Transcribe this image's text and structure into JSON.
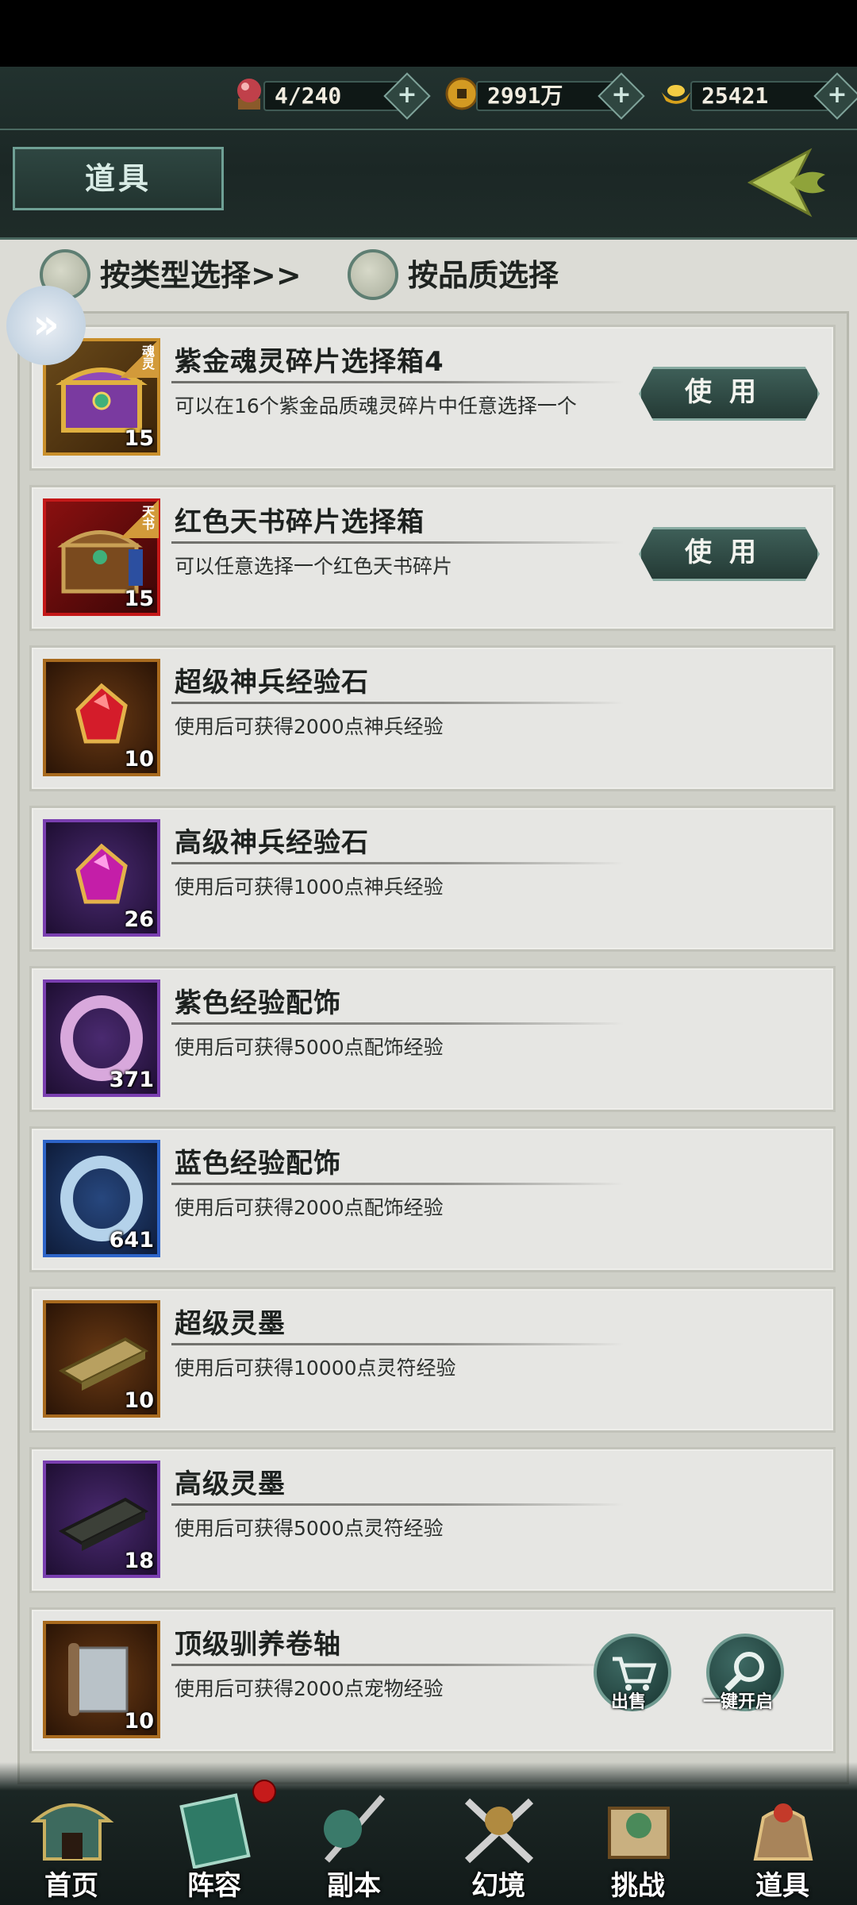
{
  "header": {
    "resources": [
      {
        "icon": "orb-icon",
        "value": "4/240"
      },
      {
        "icon": "coin-icon",
        "value": "2991万"
      },
      {
        "icon": "gold-ingot-icon",
        "value": "25421"
      }
    ],
    "title": "道具"
  },
  "filters": {
    "by_type": "按类型选择>>",
    "by_quality": "按品质选择"
  },
  "items": [
    {
      "name": "紫金魂灵碎片选择箱4",
      "desc": "可以在16个紫金品质魂灵碎片中任意选择一个",
      "qty": "15",
      "tag": "魂灵",
      "button": "使用",
      "icon": "purple-gold-chest-icon",
      "border": "#c98f2b"
    },
    {
      "name": "红色天书碎片选择箱",
      "desc": "可以任意选择一个红色天书碎片",
      "qty": "15",
      "tag": "天书",
      "button": "使用",
      "icon": "red-treasure-chest-icon",
      "border": "#c41818"
    },
    {
      "name": "超级神兵经验石",
      "desc": "使用后可获得2000点神兵经验",
      "qty": "10",
      "icon": "red-gem-icon",
      "border": "#a86a1e"
    },
    {
      "name": "高级神兵经验石",
      "desc": "使用后可获得1000点神兵经验",
      "qty": "26",
      "icon": "purple-gem-icon",
      "border": "#7a3fb0"
    },
    {
      "name": "紫色经验配饰",
      "desc": "使用后可获得5000点配饰经验",
      "qty": "371",
      "icon": "purple-ring-icon",
      "border": "#7a3fb0"
    },
    {
      "name": "蓝色经验配饰",
      "desc": "使用后可获得2000点配饰经验",
      "qty": "641",
      "icon": "blue-ring-icon",
      "border": "#2d64c8"
    },
    {
      "name": "超级灵墨",
      "desc": "使用后可获得10000点灵符经验",
      "qty": "10",
      "icon": "gold-ink-stick-icon",
      "border": "#a86a1e"
    },
    {
      "name": "高级灵墨",
      "desc": "使用后可获得5000点灵符经验",
      "qty": "18",
      "icon": "dark-ink-stick-icon",
      "border": "#7a3fb0"
    },
    {
      "name": "顶级驯养卷轴",
      "desc": "使用后可获得2000点宠物经验",
      "qty": "10",
      "icon": "scroll-icon",
      "border": "#a86a1e"
    }
  ],
  "actions": {
    "sell": "出售",
    "open_all": "一键开启"
  },
  "nav": [
    {
      "label": "首页",
      "icon": "home-pavilion-icon"
    },
    {
      "label": "阵容",
      "icon": "lineup-book-icon",
      "badge": true
    },
    {
      "label": "副本",
      "icon": "sword-warrior-icon"
    },
    {
      "label": "幻境",
      "icon": "crossed-swords-icon"
    },
    {
      "label": "挑战",
      "icon": "challenge-scroll-icon"
    },
    {
      "label": "道具",
      "icon": "item-bag-icon"
    }
  ],
  "colors": {
    "accent": "#6fa095",
    "header_bg": "#1f2c29",
    "list_bg": "#e6e6e3"
  }
}
